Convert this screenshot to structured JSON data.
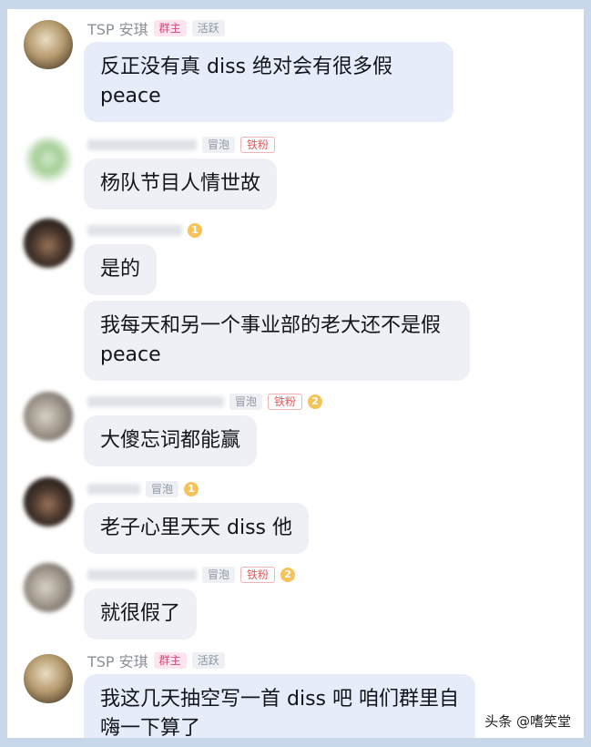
{
  "messages": [
    {
      "name": "TSP 安琪",
      "badges": [
        "群主",
        "活跃"
      ],
      "text": "反正没有真 diss 绝对会有很多假peace"
    },
    {
      "badges": [
        "冒泡",
        "铁粉"
      ],
      "text": "杨队节目人情世故"
    },
    {
      "level": "1",
      "text": "是的"
    },
    {
      "text": "我每天和另一个事业部的老大还不是假peace"
    },
    {
      "badges": [
        "冒泡",
        "铁粉"
      ],
      "level": "2",
      "text": "大傻忘词都能赢"
    },
    {
      "badges": [
        "冒泡"
      ],
      "level": "1",
      "text": "老子心里天天 diss 他"
    },
    {
      "badges": [
        "冒泡",
        "铁粉"
      ],
      "level": "2",
      "text": "就很假了"
    },
    {
      "name": "TSP 安琪",
      "badges": [
        "群主",
        "活跃"
      ],
      "text": "我这几天抽空写一首 diss 吧 咱们群里自嗨一下算了"
    }
  ],
  "watermark": "头条 @嗜笑堂",
  "colors": {
    "owner_badge": "#e0457b",
    "fan_badge": "#e55b5b",
    "owner_bubble": "#e7ecfb",
    "member_bubble": "#eef0f5",
    "background": "#c9d7ea"
  }
}
